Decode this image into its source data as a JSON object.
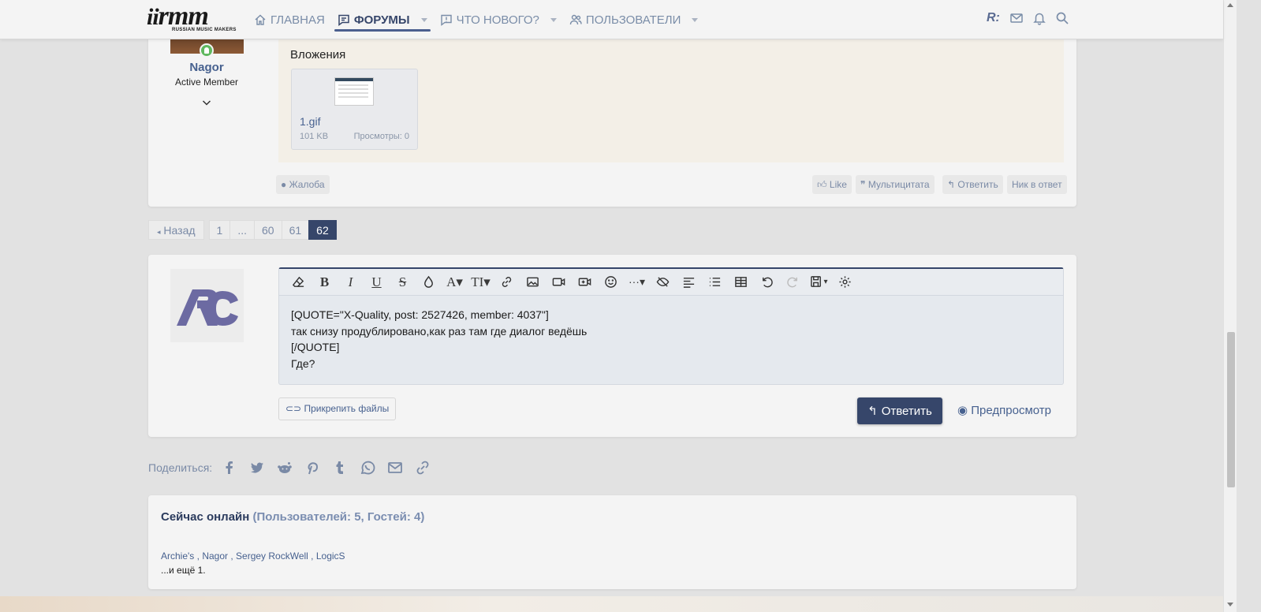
{
  "header": {
    "logo_text": "rmm",
    "logo_subtitle": "RUSSIAN MUSIC MAKERS",
    "nav": [
      {
        "label": "ГЛАВНАЯ",
        "icon": "home-icon"
      },
      {
        "label": "ФОРУМЫ",
        "icon": "forum-icon",
        "active": true
      },
      {
        "label": "ЧТО НОВОГО?",
        "icon": "whats-new-icon"
      },
      {
        "label": "ПОЛЬЗОВАТЕЛИ",
        "icon": "users-icon"
      }
    ],
    "user_initials": "R:"
  },
  "post": {
    "username": "Nagor",
    "user_title": "Active Member",
    "attachments_title": "Вложения",
    "attachment": {
      "name": "1.gif",
      "size": "101 KB",
      "views": "Просмотры: 0"
    },
    "report_label": "Жалоба",
    "like_label": "Like",
    "multiquote_label": "Мультицитата",
    "reply_label": "Ответить",
    "nick_label": "Ник в ответ"
  },
  "pagination": {
    "prev_label": "Назад",
    "pages": [
      "1",
      "...",
      "60",
      "61",
      "62"
    ],
    "current": "62"
  },
  "reply_form": {
    "lines": [
      "[QUOTE=\"X-Quality, post: 2527426, member: 4037\"]",
      "так снизу продублировано,как раз там где диалог ведёшь",
      "[/QUOTE]",
      "Где?"
    ],
    "attach_label": "Прикрепить файлы",
    "submit_label": "Ответить",
    "preview_label": "Предпросмотр"
  },
  "share": {
    "label": "Поделиться:",
    "icons": [
      "facebook-icon",
      "twitter-icon",
      "reddit-icon",
      "pinterest-icon",
      "tumblr-icon",
      "whatsapp-icon",
      "email-icon",
      "link-icon"
    ]
  },
  "online": {
    "title": "Сейчас онлайн",
    "counts": "(Пользователей: 5, Гостей: 4)",
    "users": [
      "Archie's",
      "Nagor",
      "Sergey RockWell",
      "LogicS"
    ],
    "more": "...и ещё 1."
  },
  "colors": {
    "accent": "#36466a",
    "link": "#47618f",
    "muted": "#7a8aa6",
    "online_dot": "#5fb85f"
  }
}
